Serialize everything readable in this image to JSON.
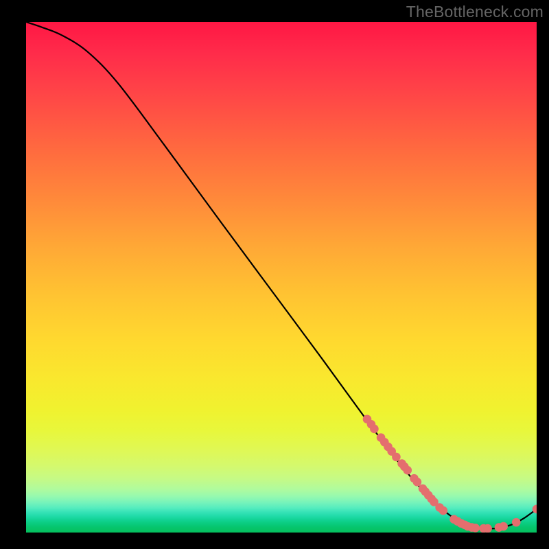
{
  "attribution": "TheBottleneck.com",
  "chart_data": {
    "type": "line",
    "title": "",
    "xlabel": "",
    "ylabel": "",
    "xlim": [
      0,
      100
    ],
    "ylim": [
      0,
      100
    ],
    "series": [
      {
        "name": "curve",
        "points": [
          {
            "x": 0,
            "y": 100
          },
          {
            "x": 3,
            "y": 99
          },
          {
            "x": 7,
            "y": 97.4
          },
          {
            "x": 12,
            "y": 94.2
          },
          {
            "x": 18,
            "y": 88.0
          },
          {
            "x": 27,
            "y": 76.0
          },
          {
            "x": 38,
            "y": 61.0
          },
          {
            "x": 48,
            "y": 47.5
          },
          {
            "x": 58,
            "y": 34.0
          },
          {
            "x": 66,
            "y": 23.0
          },
          {
            "x": 72,
            "y": 15.0
          },
          {
            "x": 77,
            "y": 9.0
          },
          {
            "x": 81,
            "y": 5.0
          },
          {
            "x": 84.5,
            "y": 2.4
          },
          {
            "x": 88,
            "y": 1.0
          },
          {
            "x": 92,
            "y": 0.8
          },
          {
            "x": 95,
            "y": 1.5
          },
          {
            "x": 97.5,
            "y": 2.8
          },
          {
            "x": 100,
            "y": 4.6
          }
        ]
      },
      {
        "name": "markers",
        "points": [
          {
            "x": 66.8,
            "y": 22.2
          },
          {
            "x": 67.6,
            "y": 21.2
          },
          {
            "x": 68.2,
            "y": 20.3
          },
          {
            "x": 69.5,
            "y": 18.6
          },
          {
            "x": 70.2,
            "y": 17.7
          },
          {
            "x": 70.9,
            "y": 16.8
          },
          {
            "x": 71.6,
            "y": 15.9
          },
          {
            "x": 72.5,
            "y": 14.8
          },
          {
            "x": 73.6,
            "y": 13.5
          },
          {
            "x": 74.1,
            "y": 12.9
          },
          {
            "x": 74.7,
            "y": 12.2
          },
          {
            "x": 76.0,
            "y": 10.6
          },
          {
            "x": 76.6,
            "y": 9.9
          },
          {
            "x": 77.7,
            "y": 8.6
          },
          {
            "x": 78.2,
            "y": 8.0
          },
          {
            "x": 78.8,
            "y": 7.3
          },
          {
            "x": 79.4,
            "y": 6.6
          },
          {
            "x": 79.9,
            "y": 6.0
          },
          {
            "x": 81.0,
            "y": 4.9
          },
          {
            "x": 81.7,
            "y": 4.3
          },
          {
            "x": 83.8,
            "y": 2.6
          },
          {
            "x": 84.5,
            "y": 2.2
          },
          {
            "x": 85.2,
            "y": 1.8
          },
          {
            "x": 85.9,
            "y": 1.5
          },
          {
            "x": 86.5,
            "y": 1.2
          },
          {
            "x": 87.3,
            "y": 1.0
          },
          {
            "x": 88.0,
            "y": 0.9
          },
          {
            "x": 89.6,
            "y": 0.8
          },
          {
            "x": 90.4,
            "y": 0.8
          },
          {
            "x": 92.6,
            "y": 1.0
          },
          {
            "x": 93.5,
            "y": 1.2
          },
          {
            "x": 96.0,
            "y": 2.0
          },
          {
            "x": 100.0,
            "y": 4.6
          }
        ]
      }
    ]
  }
}
